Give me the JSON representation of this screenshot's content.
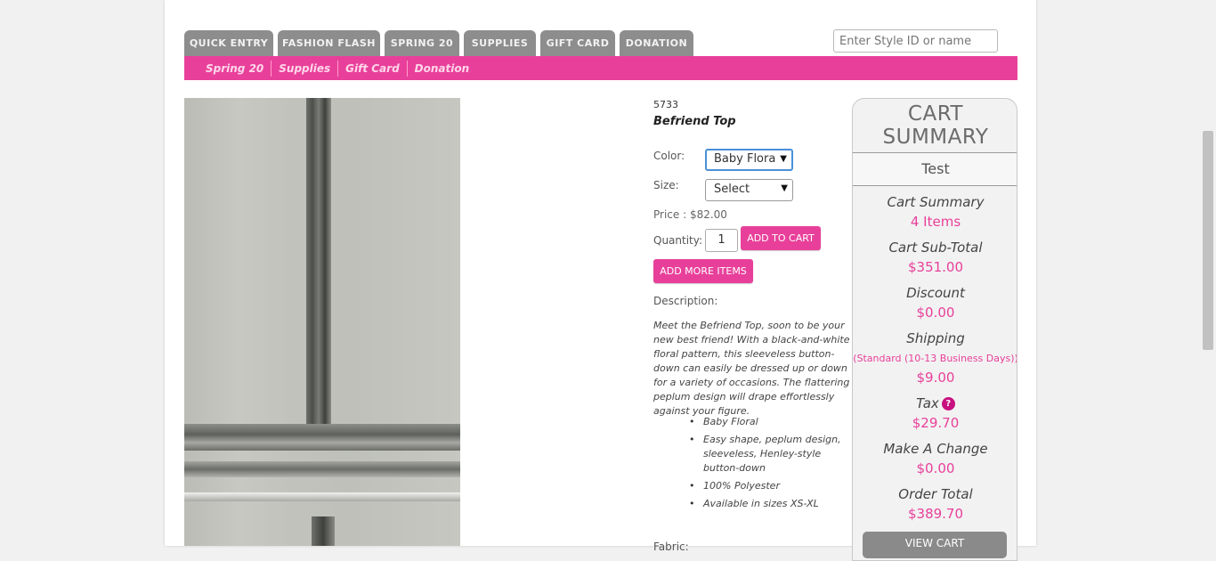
{
  "tabs": [
    {
      "label": "QUICK ENTRY"
    },
    {
      "label": "FASHION FLASH"
    },
    {
      "label": "SPRING 20"
    },
    {
      "label": "SUPPLIES"
    },
    {
      "label": "GIFT CARD"
    },
    {
      "label": "DONATION"
    }
  ],
  "search": {
    "placeholder": "Enter Style ID or name"
  },
  "subnav": [
    {
      "label": "Spring 20"
    },
    {
      "label": "Supplies"
    },
    {
      "label": "Gift Card"
    },
    {
      "label": "Donation"
    }
  ],
  "product": {
    "style_id": "5733",
    "name": "Befriend Top",
    "color_label": "Color:",
    "color_value": "Baby Flora",
    "size_label": "Size:",
    "size_value": "Select",
    "price": "Price : $82.00",
    "quantity_label": "Quantity:",
    "quantity": "1",
    "add_to_cart": "ADD TO CART",
    "add_more_items": "ADD MORE ITEMS",
    "description_label": "Description:",
    "description": "Meet the Befriend Top, soon to be your new best friend! With a black-and-white floral pattern, this sleeveless button-down can easily be dressed up or down for a variety of occasions. The flattering peplum design will drape effortlessly against your figure.",
    "bullets": [
      "Baby Floral",
      "Easy shape, peplum design, sleeveless, Henley-style button-down",
      "100% Polyester",
      "Available in sizes XS-XL"
    ],
    "fabric_label": "Fabric:"
  },
  "cart": {
    "title": "CART SUMMARY",
    "user": "Test",
    "summary_label": "Cart Summary",
    "summary_value": "4 Items",
    "subtotal_label": "Cart Sub-Total",
    "subtotal_value": "$351.00",
    "discount_label": "Discount",
    "discount_value": "$0.00",
    "shipping_label": "Shipping",
    "shipping_method": "(Standard (10-13 Business Days))",
    "shipping_value": "$9.00",
    "tax_label": "Tax",
    "tax_help": "?",
    "tax_value": "$29.70",
    "change_label": "Make A Change",
    "change_value": "$0.00",
    "total_label": "Order Total",
    "total_value": "$389.70",
    "view_cart": "VIEW CART"
  },
  "colors": {
    "accent": "#e8409a",
    "tab": "#8d8d8d"
  }
}
